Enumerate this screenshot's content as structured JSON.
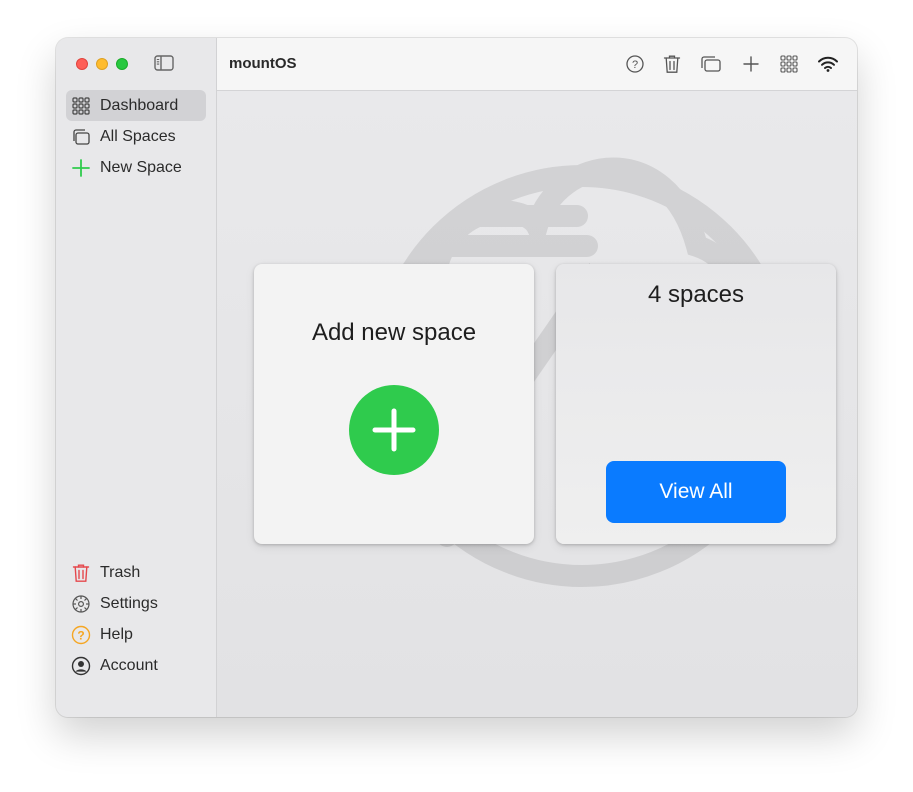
{
  "app": {
    "title": "mountOS"
  },
  "sidebar": {
    "items": [
      {
        "label": "Dashboard",
        "icon": "grid-icon",
        "active": true
      },
      {
        "label": "All Spaces",
        "icon": "stacked-windows-icon"
      },
      {
        "label": "New Space",
        "icon": "plus-icon",
        "color": "#2fcb4d"
      }
    ],
    "bottom_items": [
      {
        "label": "Trash",
        "icon": "trash-icon",
        "color": "#e5484d"
      },
      {
        "label": "Settings",
        "icon": "gear-icon"
      },
      {
        "label": "Help",
        "icon": "question-icon",
        "color": "#f5a623"
      },
      {
        "label": "Account",
        "icon": "person-icon"
      }
    ]
  },
  "toolbar": {
    "icons": [
      "help-icon",
      "trash-icon",
      "stacked-windows-icon",
      "plus-icon",
      "grid-icon",
      "wifi-icon"
    ]
  },
  "main": {
    "add_card": {
      "title": "Add new space"
    },
    "spaces_card": {
      "title": "4 spaces",
      "button_label": "View All"
    }
  },
  "colors": {
    "accent_blue": "#0a7bff",
    "accent_green": "#2fcb4d"
  }
}
